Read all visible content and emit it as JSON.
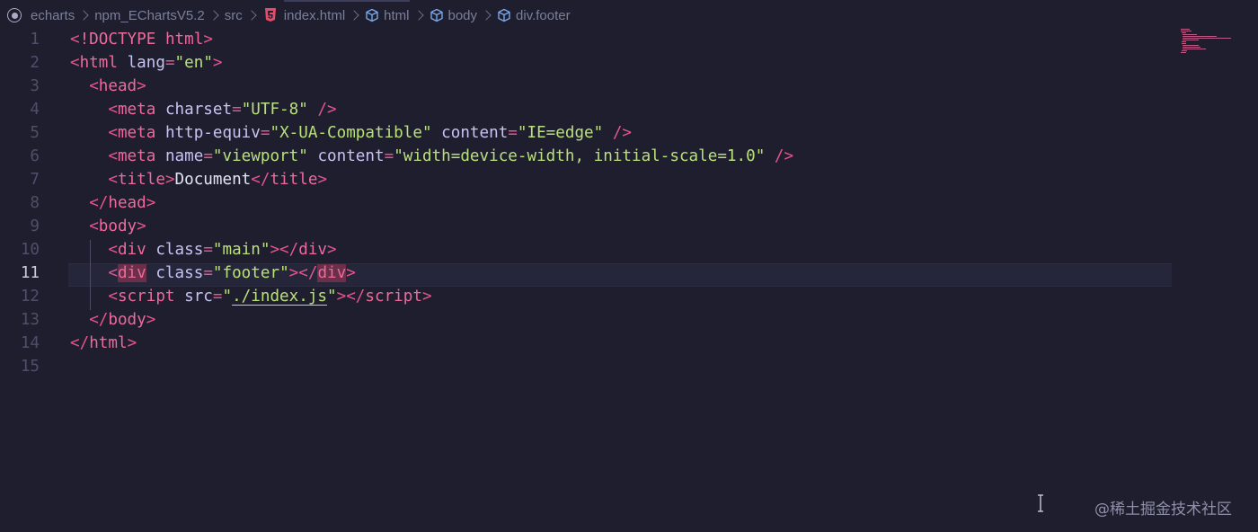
{
  "breadcrumb": {
    "root": "echarts",
    "folder": "npm_EChartsV5.2",
    "subfolder": "src",
    "file": "index.html",
    "path": [
      "html",
      "body",
      "div.footer"
    ]
  },
  "editor": {
    "active_line": 11,
    "lines": [
      {
        "n": "1"
      },
      {
        "n": "2"
      },
      {
        "n": "3"
      },
      {
        "n": "4"
      },
      {
        "n": "5"
      },
      {
        "n": "6"
      },
      {
        "n": "7"
      },
      {
        "n": "8"
      },
      {
        "n": "9"
      },
      {
        "n": "10"
      },
      {
        "n": "11"
      },
      {
        "n": "12"
      },
      {
        "n": "13"
      },
      {
        "n": "14"
      },
      {
        "n": "15"
      }
    ],
    "code": {
      "l1": {
        "doctype": "!DOCTYPE",
        "kw": "html"
      },
      "l2": {
        "tag": "html",
        "attr": "lang",
        "val": "en"
      },
      "l3": {
        "tag": "head"
      },
      "l4": {
        "tag": "meta",
        "attr": "charset",
        "val": "UTF-8"
      },
      "l5": {
        "tag": "meta",
        "attr1": "http-equiv",
        "val1": "X-UA-Compatible",
        "attr2": "content",
        "val2": "IE=edge"
      },
      "l6": {
        "tag": "meta",
        "attr1": "name",
        "val1": "viewport",
        "attr2": "content",
        "val2": "width=device-width, initial-scale=1.0"
      },
      "l7": {
        "tag": "title",
        "text": "Document"
      },
      "l8": {
        "tag": "head"
      },
      "l9": {
        "tag": "body"
      },
      "l10": {
        "tag": "div",
        "attr": "class",
        "val": "main"
      },
      "l11": {
        "tag": "div",
        "attr": "class",
        "val": "footer"
      },
      "l12": {
        "tag": "script",
        "attr": "src",
        "val": "./index.js"
      },
      "l13": {
        "tag": "body"
      },
      "l14": {
        "tag": "html"
      }
    }
  },
  "watermark": "@稀土掘金技术社区",
  "colors": {
    "background": "#1f1e2e",
    "tag": "#ec6a9c",
    "string": "#b9e07c",
    "attribute": "#c7c3f2",
    "highlight": "#6b2f4a"
  }
}
